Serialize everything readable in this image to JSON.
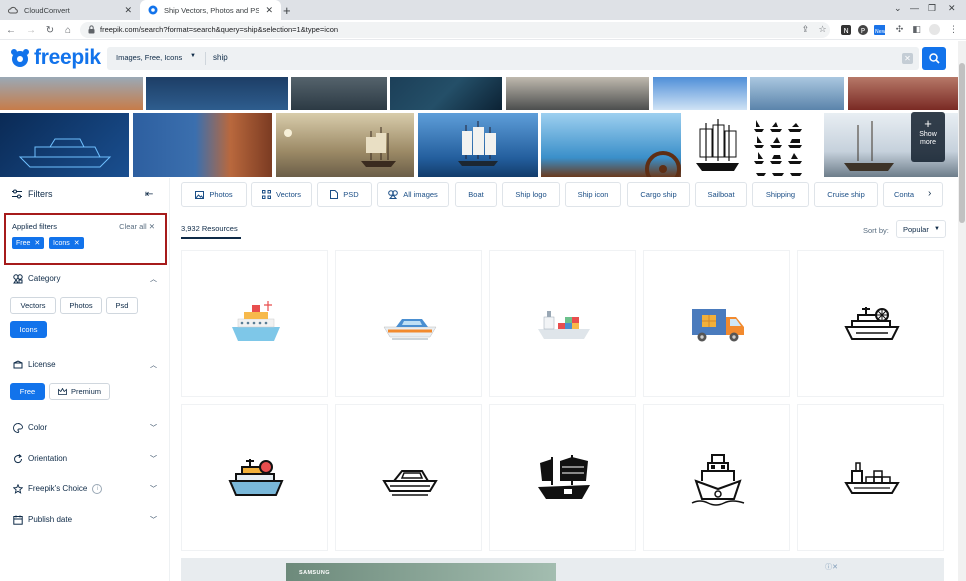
{
  "browser": {
    "tabs": [
      {
        "title": "CloudConvert",
        "active": false
      },
      {
        "title": "Ship Vectors, Photos and PSD fi",
        "active": true
      }
    ],
    "url": "freepik.com/search?format=search&query=ship&selection=1&type=icon"
  },
  "header": {
    "logo": "freepik",
    "search_type": "Images, Free, Icons",
    "search_query": "ship"
  },
  "image_strip": {
    "show_more": "Show more"
  },
  "sidebar": {
    "title": "Filters",
    "applied": {
      "title": "Applied filters",
      "clear_all": "Clear all ✕",
      "chips": [
        "Free",
        "Icons"
      ]
    },
    "category": {
      "title": "Category",
      "options": [
        "Vectors",
        "Photos",
        "Psd",
        "Icons"
      ],
      "selected": "Icons"
    },
    "license": {
      "title": "License",
      "options": [
        "Free",
        "Premium"
      ],
      "selected": "Free"
    },
    "color": {
      "title": "Color"
    },
    "orientation": {
      "title": "Orientation"
    },
    "freepiks_choice": {
      "title": "Freepik's Choice"
    },
    "publish_date": {
      "title": "Publish date"
    }
  },
  "main": {
    "chips": [
      "Photos",
      "Vectors",
      "PSD",
      "All images",
      "Boat",
      "Ship logo",
      "Ship icon",
      "Cargo ship",
      "Sailboat",
      "Shipping",
      "Cruise ship",
      "Conta"
    ],
    "resources_count": "3,932 Resources",
    "sort_label": "Sort by:",
    "sort_value": "Popular",
    "results": [
      {
        "icon": "colored-cruise-ship-icon"
      },
      {
        "icon": "colored-speedboat-icon"
      },
      {
        "icon": "colored-cargo-ship-icon"
      },
      {
        "icon": "colored-delivery-truck-icon"
      },
      {
        "icon": "outline-ship-with-wheel-icon"
      },
      {
        "icon": "filled-ship-with-wheel-icon"
      },
      {
        "icon": "outline-yacht-icon"
      },
      {
        "icon": "solid-junk-ship-icon"
      },
      {
        "icon": "outline-ship-front-icon"
      },
      {
        "icon": "outline-cargo-ship-icon"
      }
    ]
  },
  "ad": {
    "brand": "SAMSUNG"
  },
  "colors": {
    "brand_blue": "#1273eb",
    "applied_filter_border": "#a61b1b",
    "text_dark": "#0e2a47"
  }
}
